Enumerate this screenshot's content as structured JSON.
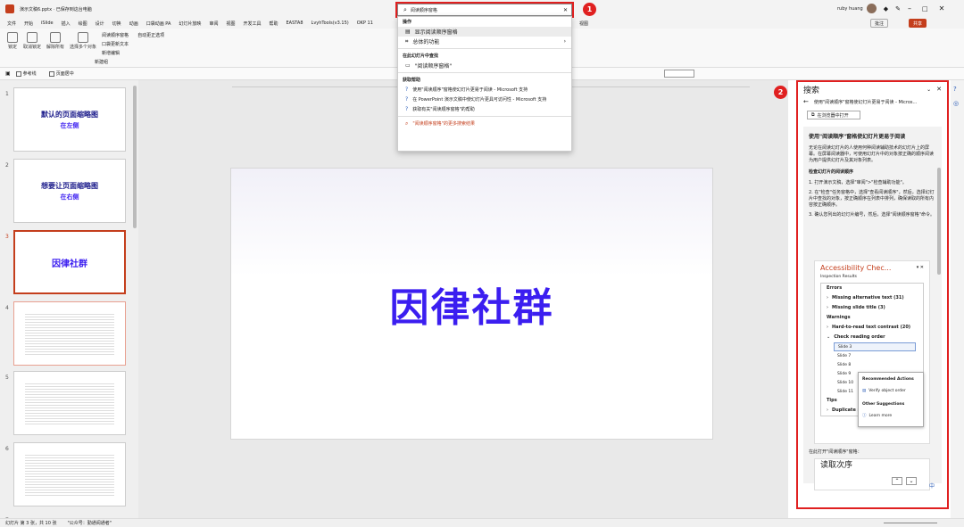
{
  "titlebar": {
    "filename": "演示文稿6.pptx · 已保存到这台电脑",
    "user": "ruby huang"
  },
  "menu": [
    "文件",
    "开始",
    "iSlide",
    "插入",
    "绘图",
    "设计",
    "切换",
    "动画",
    "口袋动画 PA",
    "幻灯片放映",
    "审阅",
    "视图",
    "开发工具",
    "帮助",
    "EASTA8",
    "LvyhTools(v3.15)",
    "OKP 11"
  ],
  "ribbon": {
    "buttons": [
      "锁定",
      "取消锁定",
      "解除所有",
      "选择多个对象",
      "阅读顺序窗格",
      "自动更正选项",
      "口袋更新文本",
      "新增编辑"
    ],
    "group_label": "新建组",
    "right_menu": "视图",
    "share": "共享",
    "comments": "批注"
  },
  "qat": {
    "checkbox1": "参考线",
    "checkbox2": "页面居中"
  },
  "search": {
    "query": "阅读顺序窗格",
    "badge": "1"
  },
  "dropdown": {
    "actions_head": "操作",
    "action1": "显示阅读顺序窗格",
    "action2": "总体的功能",
    "slides_head": "在此幻灯片中查找",
    "slide_result": "\"阅读顺序窗格\"",
    "help_head": "获取帮助",
    "help1": "使用\"阅读顺序\"窗格使幻灯片更易于阅读 - Microsoft 支持",
    "help2": "在 PowerPoint 演示文稿中使幻灯片更具可访问性 - Microsoft 支持",
    "help3": "获取有关\"阅读顺序窗格\"的帮助",
    "more": "\"阅读顺序窗格\"的更多搜索结果"
  },
  "thumbs": [
    {
      "num": "1",
      "line1": "默认的页面缩略图",
      "line2": "在左侧"
    },
    {
      "num": "2",
      "line1": "想要让页面缩略图",
      "line2": "在右侧"
    },
    {
      "num": "3",
      "line1": "因律社群",
      "line2": ""
    },
    {
      "num": "4",
      "line1": "",
      "line2": ""
    },
    {
      "num": "5",
      "line1": "",
      "line2": ""
    },
    {
      "num": "6",
      "line1": "",
      "line2": ""
    },
    {
      "num": "7",
      "line1": "",
      "line2": ""
    }
  ],
  "slide": {
    "title": "因律社群"
  },
  "pane": {
    "title": "搜索",
    "badge": "2",
    "nav_title": "使用\"阅读顺序\"窗格使幻灯片更易于阅读 - Micros...",
    "open_btn": "在浏览器中打开",
    "article_title": "使用\"阅读顺序\"窗格使幻灯片更易于阅读",
    "para1": "无论在阅读幻灯片的人使用何种阅读辅助技术的幻灯片上的屏幕。在屏幕阅读器中，可使用幻灯片中的对象按正确的顺序阅读为用户提供幻灯片及其对象列表。",
    "subhead": "检查幻灯片的阅读顺序",
    "step1": "打开演示文稿，选择\"审阅\">\"检查辅助功能\"。",
    "step2": "在\"检查\"任务窗格中，选择\"查看阅读顺序\"，然后，选择幻灯片中查找的对象，按正确顺序在列表中排列，确保读取的所有内容按正确顺序。",
    "step3": "确认您列出的幻灯片编号，然后，选择\"阅读顺序窗格\"命令。",
    "acc": {
      "title": "Accessibility Chec...",
      "results": "Inspection Results",
      "errors": "Errors",
      "err1": "Missing alternative text (31)",
      "err2": "Missing slide title (3)",
      "warnings": "Warnings",
      "warn1": "Hard-to-read text contrast (20)",
      "warn2": "Check reading order",
      "slides": [
        "Slide 3",
        "Slide 7",
        "Slide 8",
        "Slide 9",
        "Slide 10",
        "Slide 11"
      ],
      "rec_head": "Recommended Actions",
      "rec1": "Verify object order",
      "other_head": "Other Suggestions",
      "other1": "Learn more",
      "tips": "Tips",
      "tip1": "Duplicate slide title (4)"
    },
    "caption": "在此打开\"阅读顺序\"窗格：",
    "reading_title": "读取次序"
  },
  "status": {
    "slide": "幻灯片 第 3 张，共 10 张",
    "lang": "\"公众号：勤通阅通者\""
  },
  "ime": "中"
}
